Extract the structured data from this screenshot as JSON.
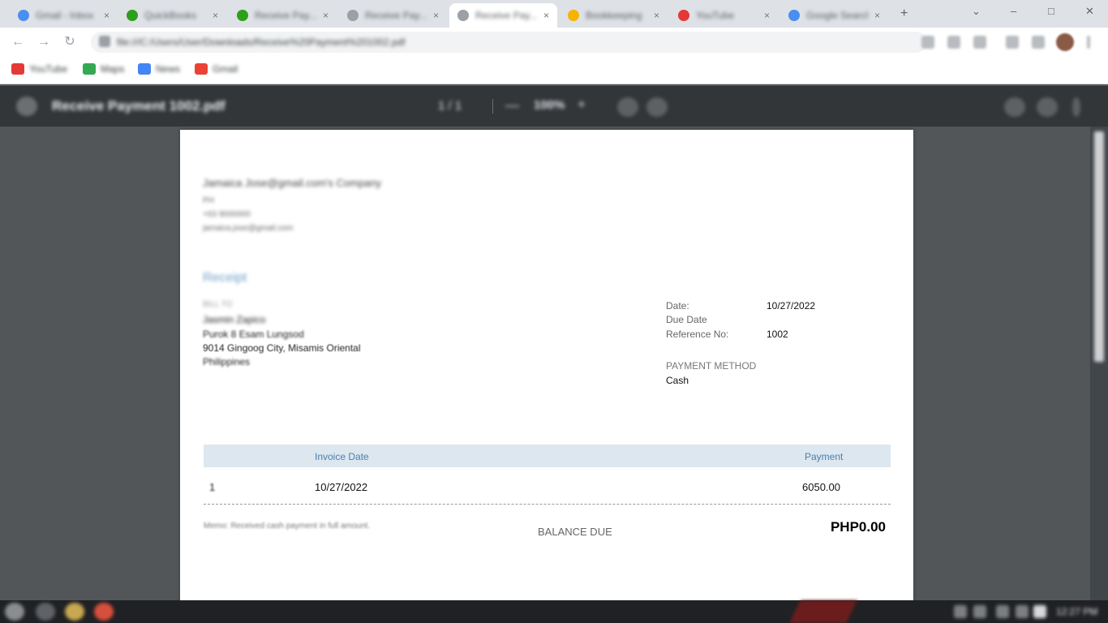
{
  "browser": {
    "tabs": [
      {
        "label": "Gmail - Inbox",
        "favicon_color": "#4a8ff0",
        "active": false
      },
      {
        "label": "QuickBooks",
        "favicon_color": "#2ca01c",
        "active": false
      },
      {
        "label": "Receive Pay...",
        "favicon_color": "#2ca01c",
        "active": false
      },
      {
        "label": "Receive Pay...",
        "favicon_color": "#9aa0a6",
        "active": false
      },
      {
        "label": "Receive Pay...",
        "favicon_color": "#9aa0a6",
        "active": true
      },
      {
        "label": "Bookkeeping",
        "favicon_color": "#f4b400",
        "active": false
      },
      {
        "label": "YouTube",
        "favicon_color": "#e53935",
        "active": false
      },
      {
        "label": "Google Search",
        "favicon_color": "#4a8ff0",
        "active": false
      }
    ],
    "new_tab_glyph": "+",
    "close_glyph": "×",
    "window_controls": [
      "⌄",
      "–",
      "□",
      "✕"
    ],
    "url": "file:///C:/Users/User/Downloads/Receive%20Payment%201002.pdf",
    "bookmarks": [
      {
        "label": "YouTube",
        "color": "#e53935"
      },
      {
        "label": "Maps",
        "color": "#34a853"
      },
      {
        "label": "News",
        "color": "#4285f4"
      },
      {
        "label": "Gmail",
        "color": "#ea4335"
      }
    ]
  },
  "pdf_viewer": {
    "title": "Receive Payment 1002.pdf",
    "page_info": "1 / 1",
    "zoom_minus": "—",
    "zoom": "100%",
    "zoom_plus": "+"
  },
  "document": {
    "company": {
      "name": "Jamaica Jose@gmail.com's Company",
      "lines": [
        "PH",
        "+63 9000000",
        "jamaica.jose@gmail.com"
      ]
    },
    "title": "Receipt",
    "bill_to_label": "BILL TO",
    "bill_to_lines": [
      "Jasmin Zapico",
      "Purok 8 Esam Lungsod",
      "9014 Gingoog City, Misamis Oriental",
      "Philippines"
    ],
    "meta": {
      "date_label": "Date:",
      "date_value": "10/27/2022",
      "due_label": "Due Date",
      "ref_label": "Reference No:",
      "ref_value": "1002"
    },
    "payment_method_label": "PAYMENT METHOD",
    "payment_method_value": "Cash",
    "table": {
      "headers": {
        "invoice_date": "Invoice Date",
        "payment": "Payment"
      },
      "rows": [
        {
          "no": "1",
          "invoice_date": "10/27/2022",
          "payment": "6050.00"
        }
      ]
    },
    "notes": "Memo: Received cash payment in full amount.",
    "balance_label": "BALANCE DUE",
    "balance_value": "PHP0.00"
  },
  "taskbar": {
    "clock": "12:27 PM",
    "apps": [
      {
        "color": "#8a8d90"
      },
      {
        "color": "#5f6368"
      },
      {
        "color": "#c8a850"
      },
      {
        "color": "#d94f3d"
      }
    ]
  }
}
